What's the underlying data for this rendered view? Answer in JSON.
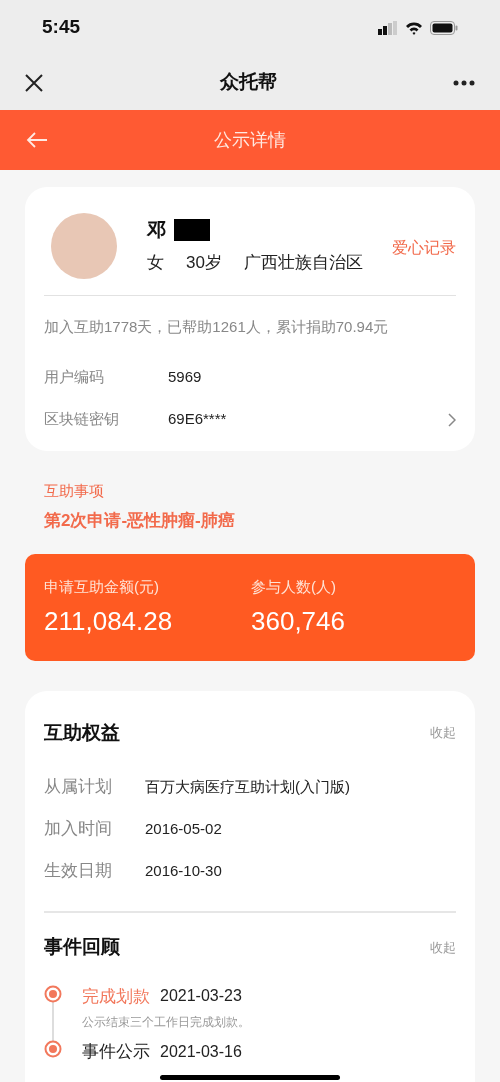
{
  "status_bar": {
    "time": "5:45"
  },
  "nav_bar": {
    "title": "众托帮"
  },
  "header": {
    "title": "公示详情"
  },
  "profile": {
    "name": "邓",
    "name_redacted": true,
    "gender": "女",
    "age": "30岁",
    "region": "广西壮族自治区",
    "link": "爱心记录",
    "summary": "加入互助1778天，已帮助1261人，累计捐助70.94元",
    "fields": [
      {
        "label": "用户编码",
        "value": "5969",
        "has_arrow": false
      },
      {
        "label": "区块链密钥",
        "value": "69E6****",
        "has_arrow": true
      }
    ]
  },
  "matter": {
    "label": "互助事项",
    "title": "第2次申请-恶性肿瘤-肺癌"
  },
  "stats": [
    {
      "label": "申请互助金额(元)",
      "value": "211,084.28"
    },
    {
      "label": "参与人数(人)",
      "value": "360,746"
    }
  ],
  "benefits": {
    "title": "互助权益",
    "toggle": "收起",
    "rows": [
      {
        "label": "从属计划",
        "value": "百万大病医疗互助计划(入门版)"
      },
      {
        "label": "加入时间",
        "value": "2016-05-02"
      },
      {
        "label": "生效日期",
        "value": "2016-10-30"
      }
    ]
  },
  "events": {
    "title": "事件回顾",
    "toggle": "收起",
    "items": [
      {
        "title": "完成划款",
        "date": "2021-03-23",
        "description": "公示结束三个工作日完成划款。",
        "highlighted": true
      },
      {
        "title": "事件公示",
        "date": "2021-03-16",
        "highlighted": false
      }
    ]
  }
}
